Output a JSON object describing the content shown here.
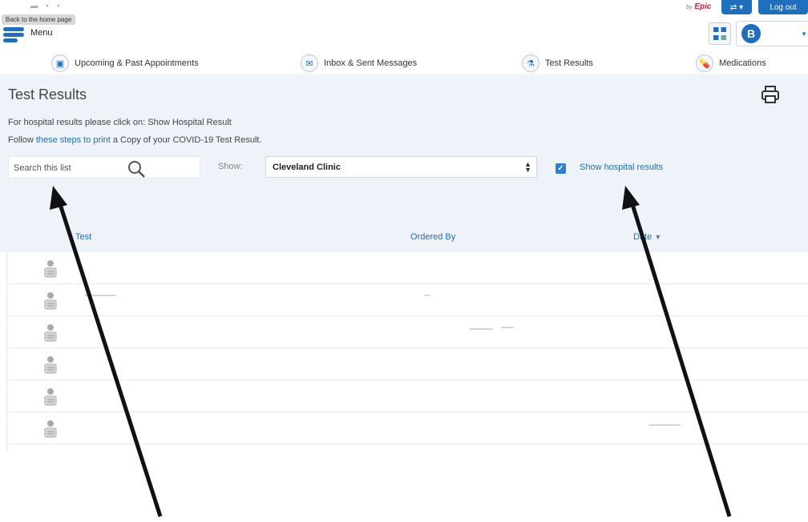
{
  "topbar": {
    "tooltip": "Back to the home page",
    "menu_label": "Menu",
    "top_dots": "▬ ▪ ▪",
    "epic_prefix": "by",
    "epic_logo": "Epic",
    "toggle_label": "⇄ ▾",
    "logout_label": "Log out",
    "avatar_initial": "B",
    "avatar_caret": "▼"
  },
  "nav": {
    "items": [
      {
        "label": "Upcoming & Past Appointments",
        "icon": "calendar-icon",
        "glyph": "▣"
      },
      {
        "label": "Inbox & Sent Messages",
        "icon": "envelope-icon",
        "glyph": "✉"
      },
      {
        "label": "Test Results",
        "icon": "flask-icon",
        "glyph": "⚗"
      },
      {
        "label": "Medications",
        "icon": "pills-icon",
        "glyph": "💊"
      }
    ]
  },
  "main": {
    "title": "Test Results",
    "info_line1": "For hospital results please click on: Show Hospital Result",
    "info_line2_pre": "Follow ",
    "info_line2_link": "these steps to print",
    "info_line2_post": " a Copy of your COVID-19 Test Result.",
    "search_placeholder": "Search this list",
    "show_label": "Show:",
    "select_value": "Cleveland Clinic",
    "checkbox_checked": true,
    "checkbox_label": "Show hospital results"
  },
  "table": {
    "headers": {
      "test": "Test",
      "ordered_by": "Ordered By",
      "date": "Date"
    },
    "sort_indicator": "▼"
  },
  "rows": [
    {
      "name": "row-1"
    },
    {
      "name": "row-2"
    },
    {
      "name": "row-3"
    },
    {
      "name": "row-4"
    },
    {
      "name": "row-5"
    },
    {
      "name": "row-6"
    }
  ],
  "colors": {
    "accent": "#1f6fbf",
    "band_bg": "#edf3f9",
    "epic_red": "#dd2233"
  }
}
